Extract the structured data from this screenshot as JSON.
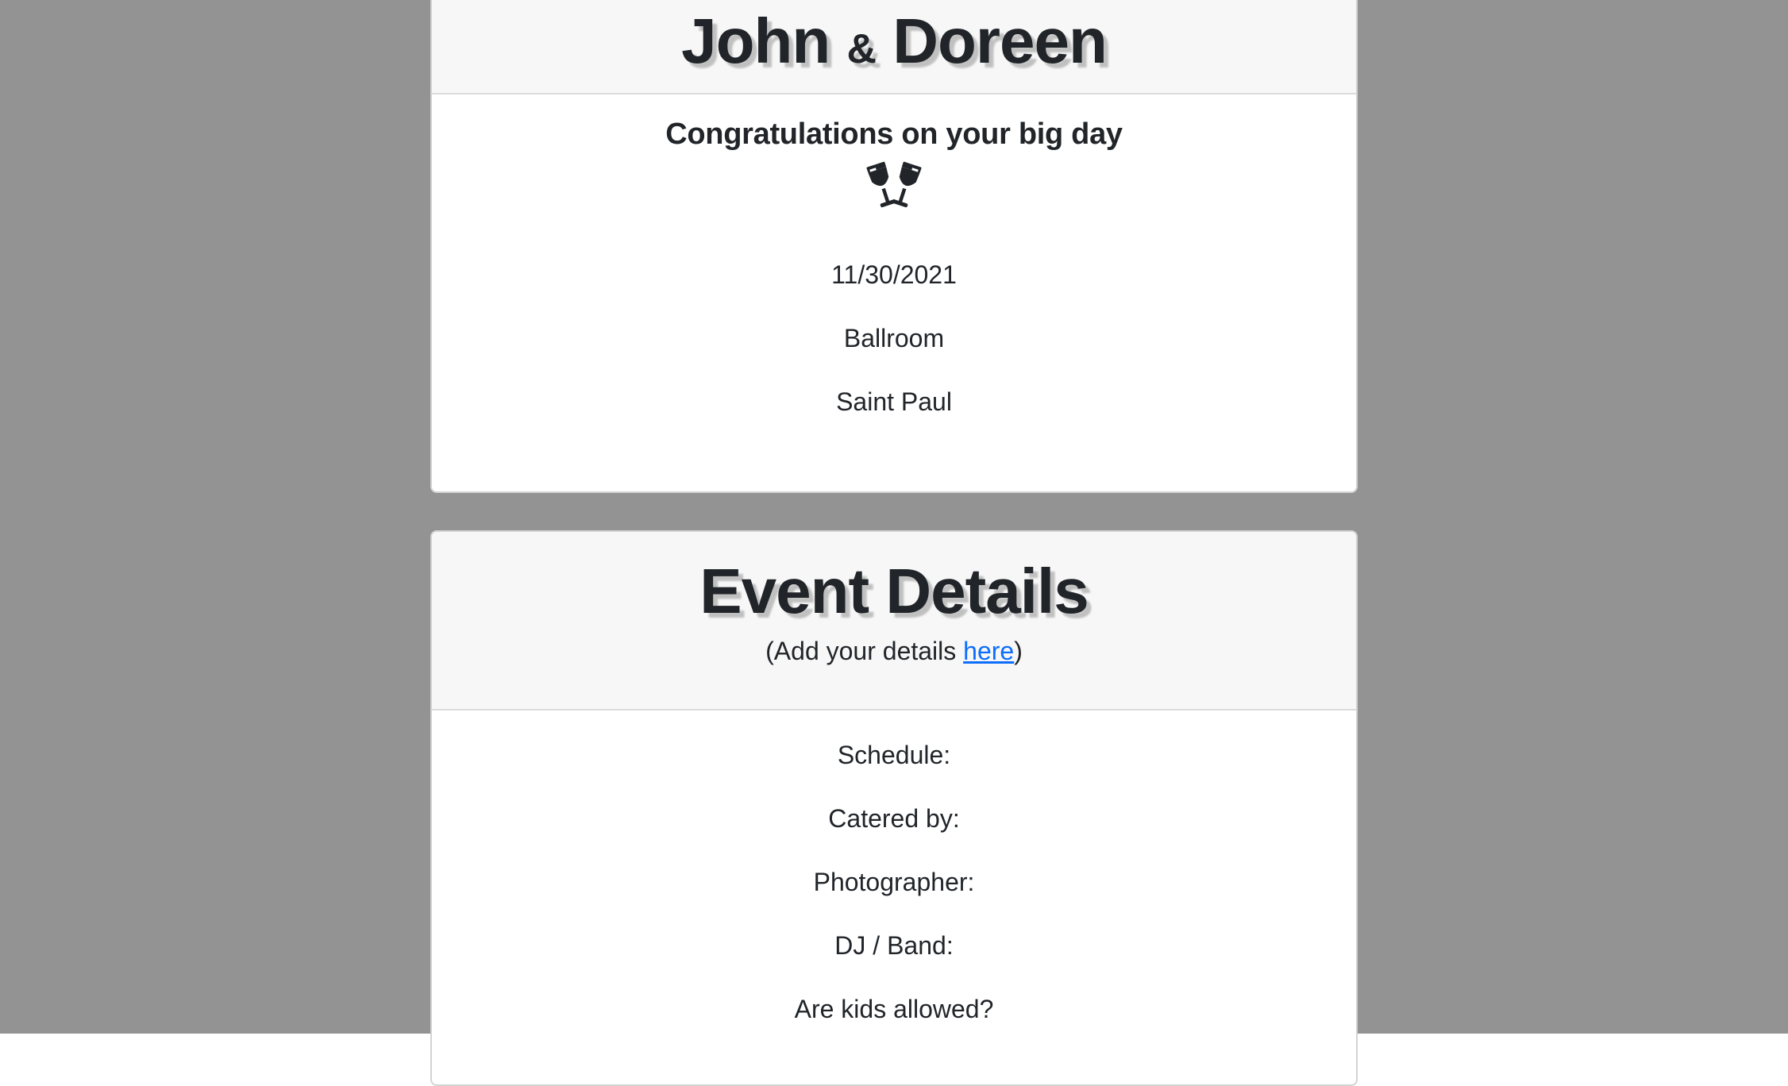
{
  "couple_card": {
    "name_first": "John",
    "ampersand": "&",
    "name_second": "Doreen",
    "congratulations": "Congratulations on your big day",
    "icon": "glass-cheers-icon",
    "date": "11/30/2021",
    "venue": "Ballroom",
    "city": "Saint Paul"
  },
  "event_card": {
    "title": "Event Details",
    "hint_prefix": "(Add your details ",
    "hint_link": "here",
    "hint_suffix": ")",
    "fields": {
      "schedule": "Schedule:",
      "catered_by": "Catered by:",
      "photographer": "Photographer:",
      "dj_band": "DJ / Band:",
      "kids_allowed": "Are kids allowed?"
    }
  },
  "colors": {
    "background": "#939393",
    "card_header": "#f7f7f7",
    "text": "#212529",
    "link": "#0d6efd"
  }
}
